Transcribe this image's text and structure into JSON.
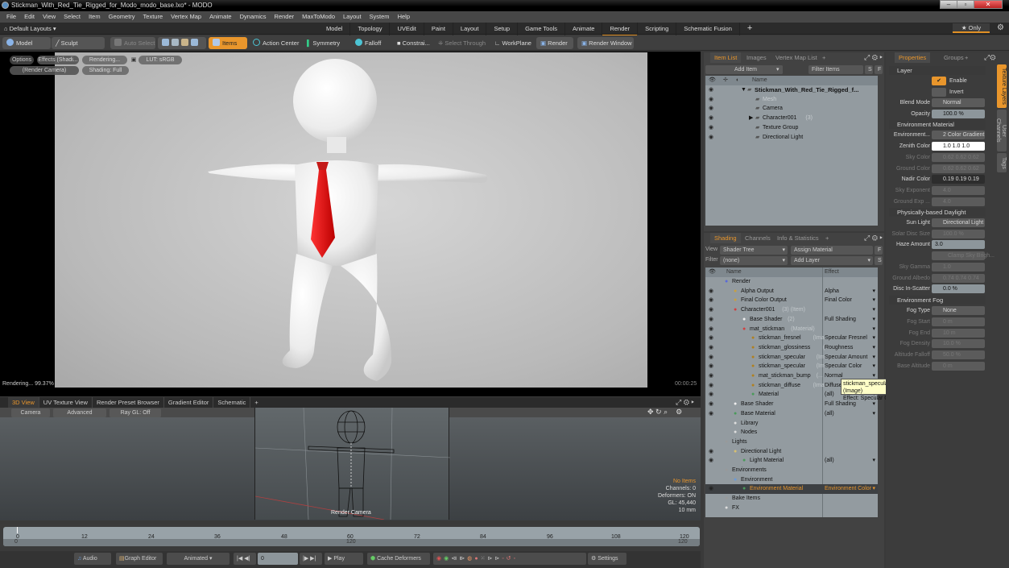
{
  "window": {
    "title": "Stickman_With_Red_Tie_Rigged_for_Modo_modo_base.lxo* - MODO",
    "controls": [
      "minimize",
      "maximize",
      "close"
    ]
  },
  "menu": [
    "File",
    "Edit",
    "View",
    "Select",
    "Item",
    "Geometry",
    "Texture",
    "Vertex Map",
    "Animate",
    "Dynamics",
    "Render",
    "MaxToModo",
    "Layout",
    "System",
    "Help"
  ],
  "layout_bar": {
    "selector": "Default Layouts ▾",
    "tabs": [
      "Model",
      "Topology",
      "UVEdit",
      "Paint",
      "Layout",
      "Setup",
      "Game Tools",
      "Animate",
      "Render",
      "Scripting",
      "Schematic Fusion"
    ],
    "active_tab": "Render",
    "add": "+",
    "only_label": "★ Only"
  },
  "toolbar": {
    "model": "Model",
    "sculpt": "Sculpt",
    "auto_select": "Auto Select",
    "items": "Items",
    "action_center": "Action Center",
    "symmetry": "Symmetry",
    "falloff": "Falloff",
    "constrain": "Constrai...",
    "select_through": "Select Through",
    "workplane": "WorkPlane",
    "render": "Render",
    "render_window": "Render Window"
  },
  "viewport": {
    "options": "Options",
    "effects": "Effects (Shadi...",
    "rendering": "Rendering...",
    "lut": "LUT: sRGB",
    "camera": "(Render Camera)",
    "shading": "Shading: Full",
    "status": "Rendering... 99.37%",
    "time": "00:00:25"
  },
  "lower_view": {
    "tabs": [
      "3D View",
      "UV Texture View",
      "Render Preset Browser",
      "Gradient Editor",
      "Schematic"
    ],
    "active_tab": "3D View",
    "buttons": [
      "Camera",
      "Advanced",
      "Ray GL: Off"
    ],
    "camera_label": "Render Camera",
    "info": {
      "items": "No Items",
      "channels": "Channels: 0",
      "deformers": "Deformers: ON",
      "gl": "GL: 45,440",
      "scale": "10 mm"
    }
  },
  "timeline": {
    "ticks": [
      "0",
      "12",
      "24",
      "36",
      "48",
      "60",
      "72",
      "84",
      "96",
      "108",
      "120"
    ],
    "range_start": "0",
    "range_end": "120",
    "mid_label": "120"
  },
  "transport": {
    "audio": "Audio",
    "graph_editor": "Graph Editor",
    "animated": "Animated",
    "frame": "0",
    "play": "Play",
    "cache_deformers": "Cache Deformers",
    "settings": "Settings"
  },
  "item_list": {
    "tabs": [
      "Item List",
      "Images",
      "Vertex Map List"
    ],
    "active_tab": "Item List",
    "add_item": "Add Item",
    "filter_items": "Filter Items",
    "s": "S",
    "f": "F",
    "column": "Name",
    "rows": [
      {
        "name": "Stickman_With_Red_Tie_Rigged_f...",
        "indent": 0,
        "bold": true,
        "expand": "▼"
      },
      {
        "name": "Mesh",
        "indent": 1,
        "dim": true
      },
      {
        "name": "Camera",
        "indent": 1
      },
      {
        "name": "Character001",
        "suffix": "(3)",
        "indent": 1,
        "expand": "▶"
      },
      {
        "name": "Texture Group",
        "indent": 1
      },
      {
        "name": "Directional Light",
        "indent": 1
      }
    ]
  },
  "shading": {
    "tabs": [
      "Shading",
      "Channels",
      "Info & Statistics"
    ],
    "active_tab": "Shading",
    "view_label": "View",
    "view_value": "Shader Tree",
    "assign_material": "Assign Material",
    "filter_label": "Filter",
    "filter_value": "(none)",
    "add_layer": "Add Layer",
    "columns": [
      "Name",
      "Effect"
    ],
    "rows": [
      {
        "name": "Render",
        "effect": "",
        "indent": 0
      },
      {
        "name": "Alpha Output",
        "effect": "Alpha",
        "indent": 1
      },
      {
        "name": "Final Color Output",
        "effect": "Final Color",
        "indent": 1
      },
      {
        "name": "Character001",
        "suffix": "(3) (Item)",
        "effect": "",
        "indent": 1
      },
      {
        "name": "Base Shader",
        "suffix": "(2)",
        "effect": "Full Shading",
        "indent": 2
      },
      {
        "name": "mat_stickman",
        "suffix": "(Material)",
        "effect": "",
        "indent": 2
      },
      {
        "name": "stickman_fresnel",
        "suffix": "(Ima...",
        "effect": "Specular Fresnel",
        "indent": 3
      },
      {
        "name": "stickman_glossiness",
        "suffix": "(...",
        "effect": "Roughness",
        "indent": 3
      },
      {
        "name": "stickman_specular",
        "suffix": "(Im...",
        "effect": "Specular Amount",
        "indent": 3
      },
      {
        "name": "stickman_specular",
        "suffix": "(Im...",
        "effect": "Specular Color",
        "indent": 3
      },
      {
        "name": "mat_stickman_bump",
        "suffix": "(...",
        "effect": "Normal",
        "indent": 3
      },
      {
        "name": "stickman_diffuse",
        "suffix": "(Ima...",
        "effect": "Diffuse",
        "indent": 3
      },
      {
        "name": "Material",
        "effect": "(all)",
        "indent": 3
      },
      {
        "name": "Base Shader",
        "effect": "Full Shading",
        "indent": 1
      },
      {
        "name": "Base Material",
        "effect": "(all)",
        "indent": 1
      },
      {
        "name": "Library",
        "effect": "",
        "indent": 1
      },
      {
        "name": "Nodes",
        "effect": "",
        "indent": 1
      },
      {
        "name": "Lights",
        "effect": "",
        "indent": 0
      },
      {
        "name": "Directional Light",
        "effect": "",
        "indent": 1
      },
      {
        "name": "Light Material",
        "effect": "(all)",
        "indent": 2
      },
      {
        "name": "Environments",
        "effect": "",
        "indent": 0
      },
      {
        "name": "Environment",
        "effect": "",
        "indent": 1
      },
      {
        "name": "Environment Material",
        "effect": "Environment Color",
        "indent": 2,
        "selected": true
      },
      {
        "name": "Bake Items",
        "effect": "",
        "indent": 0
      },
      {
        "name": "FX",
        "effect": "",
        "indent": 0
      }
    ],
    "tooltip": {
      "line1": "stickman_specular (Image)",
      "line2": "Effect: Specular Color"
    }
  },
  "properties": {
    "tabs": [
      "Properties",
      "Groups"
    ],
    "active_tab": "Properties",
    "side_tabs": [
      "Texture Layers",
      "User Channels",
      "Tags"
    ],
    "sections": {
      "layer": "Layer",
      "env_material": "Environment Material",
      "daylight": "Physically-based Daylight",
      "fog": "Environment Fog"
    },
    "layer": {
      "enable": "Enable",
      "invert": "Invert",
      "blend_mode_label": "Blend Mode",
      "blend_mode": "Normal",
      "opacity_label": "Opacity",
      "opacity": "100.0 %"
    },
    "env": {
      "environment_label": "Environment...",
      "environment": "2 Color Gradient",
      "zenith_label": "Zenith Color",
      "zenith": "1.0   1.0   1.0",
      "sky_label": "Sky Color",
      "sky": "0.62  0.62  0.62",
      "ground_label": "Ground Color",
      "ground": "0.62  0.62  0.62",
      "nadir_label": "Nadir Color",
      "nadir": "0.19  0.19  0.19",
      "sky_exp_label": "Sky Exponent",
      "sky_exp": "4.0",
      "ground_exp_label": "Ground Exp ...",
      "ground_exp": "4.0"
    },
    "daylight": {
      "sun_label": "Sun Light",
      "sun": "Directional Light",
      "solar_label": "Solar Disc Size",
      "solar": "100.0 %",
      "haze_label": "Haze Amount",
      "haze": "3.0",
      "clamp": "Clamp Sky Brigh...",
      "gamma_label": "Sky Gamma",
      "gamma": "1.0",
      "albedo_label": "Ground Albedo",
      "albedo": "0.74  0.74  0.74",
      "scatter_label": "Disc In-Scatter",
      "scatter": "0.0 %"
    },
    "fog": {
      "type_label": "Fog Type",
      "type": "None",
      "start_label": "Fog Start",
      "start": "0 m",
      "end_label": "Fog End",
      "end": "10 m",
      "density_label": "Fog Density",
      "density": "10.0 %",
      "falloff_label": "Altitude Falloff",
      "falloff": "50.0 %",
      "base_label": "Base Altitude",
      "base": "0 m"
    }
  },
  "colors": {
    "accent": "#e9962c",
    "tie": "#d8201e",
    "panel": "#424242"
  }
}
